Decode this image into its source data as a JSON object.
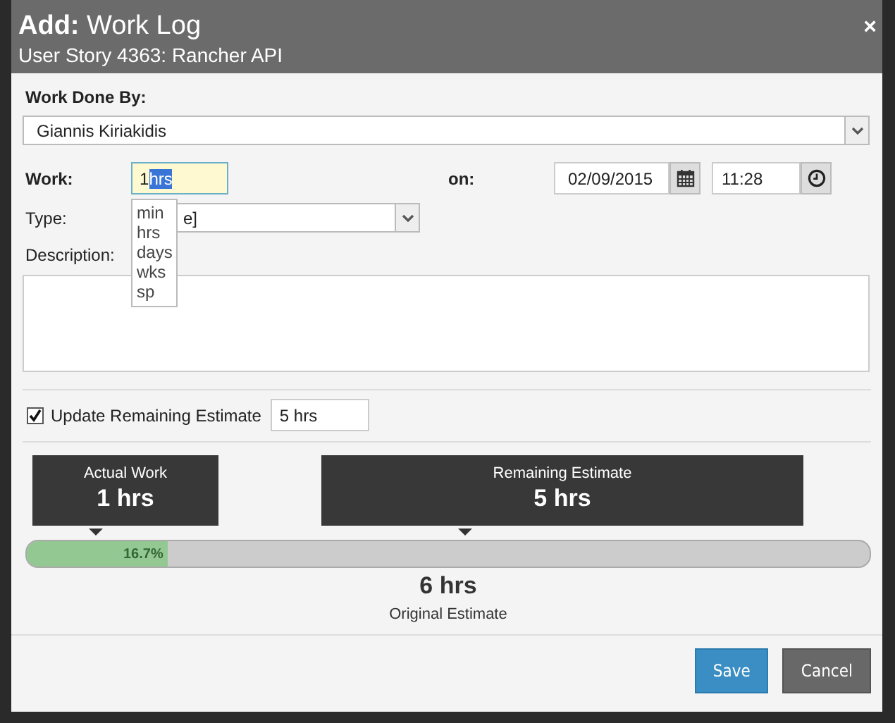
{
  "dialog": {
    "title_prefix": "Add:",
    "title": "Work Log",
    "subtitle": "User Story 4363: Rancher API",
    "close": "×"
  },
  "work_done_by": {
    "label": "Work Done By:",
    "value": "Giannis Kiriakidis"
  },
  "work": {
    "label": "Work:",
    "amount": "1",
    "unit": "hrs",
    "unit_highlighted": true,
    "unit_options": [
      {
        "label": "min",
        "selected": false
      },
      {
        "label": "hrs",
        "selected": false
      },
      {
        "label": "days",
        "selected": false
      },
      {
        "label": "wks",
        "selected": false
      },
      {
        "label": "sp",
        "selected": false
      }
    ]
  },
  "on": {
    "label": "on:",
    "date": "02/09/2015",
    "time": "11:28"
  },
  "type": {
    "label": "Type:",
    "value": "e]"
  },
  "description": {
    "label": "Description:"
  },
  "update_remaining": {
    "label": "Update Remaining Estimate",
    "checked": true,
    "value": "5 hrs"
  },
  "summary": {
    "actual": {
      "label": "Actual Work",
      "value": "1 hrs"
    },
    "remaining": {
      "label": "Remaining Estimate",
      "value": "5 hrs"
    },
    "progress": {
      "level": 0.167,
      "reading": "16.7%"
    },
    "original": {
      "value": "6 hrs",
      "label": "Original Estimate"
    }
  },
  "buttons": [
    {
      "label": "Save",
      "kind": "primary"
    },
    {
      "label": "Cancel",
      "kind": "secondary"
    }
  ]
}
